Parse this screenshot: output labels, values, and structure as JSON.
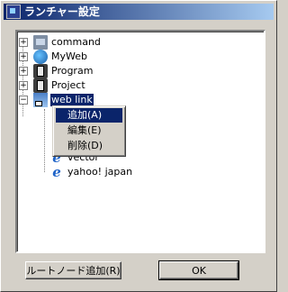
{
  "window": {
    "title": "ランチャー設定"
  },
  "tree": {
    "nodes": [
      {
        "label": "command",
        "expander": "+",
        "icon": "app-icon"
      },
      {
        "label": "MyWeb",
        "expander": "+",
        "icon": "globe-icon"
      },
      {
        "label": "Program",
        "expander": "+",
        "icon": "folder-icon"
      },
      {
        "label": "Project",
        "expander": "+",
        "icon": "folder-icon"
      },
      {
        "label": "web link",
        "expander": "−",
        "icon": "web-link-icon",
        "selected": true
      },
      {
        "label": "vector",
        "icon": "ie-icon"
      },
      {
        "label": "yahoo! japan",
        "icon": "ie-icon"
      }
    ]
  },
  "context_menu": {
    "items": [
      {
        "label": "追加(A)"
      },
      {
        "label": "編集(E)"
      },
      {
        "label": "削除(D)"
      }
    ]
  },
  "buttons": {
    "add_root": "ルートノード追加(R)",
    "ok": "OK"
  },
  "colors": {
    "title_start": "#0a246a",
    "title_end": "#a6caf0",
    "selection": "#0a246a",
    "face": "#d4d0c8"
  }
}
